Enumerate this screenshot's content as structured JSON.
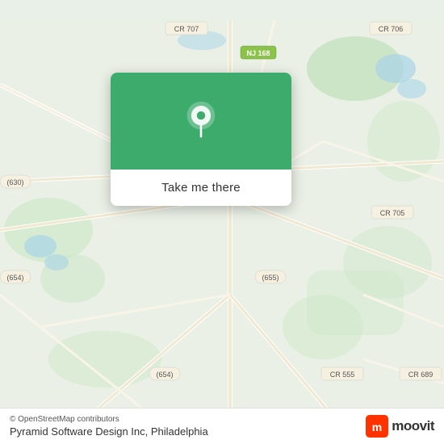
{
  "map": {
    "background_color": "#e8ede8"
  },
  "popup": {
    "button_label": "Take me there"
  },
  "bottom_bar": {
    "osm_credit": "© OpenStreetMap contributors",
    "company_name": "Pyramid Software Design Inc, Philadelphia"
  },
  "icons": {
    "location_pin": "location-pin-icon",
    "moovit": "moovit-icon"
  }
}
